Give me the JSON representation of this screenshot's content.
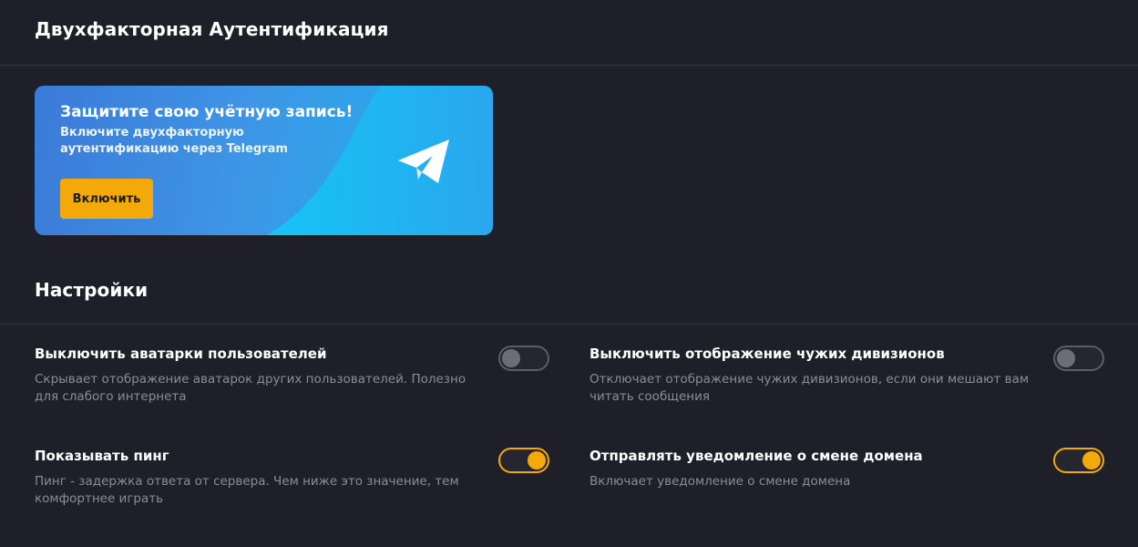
{
  "two_factor": {
    "section_title": "Двухфакторная Аутентификация",
    "banner": {
      "title": "Защитите свою учётную запись!",
      "text": "Включите двухфакторную аутентификацию через Telegram",
      "button_label": "Включить",
      "icon": "telegram-icon"
    }
  },
  "settings": {
    "section_title": "Настройки",
    "items": [
      {
        "title": "Выключить аватарки пользователей",
        "description": "Скрывает отображение аватарок других пользователей. Полезно для слабого интернета",
        "enabled": false
      },
      {
        "title": "Выключить отображение чужих дивизионов",
        "description": "Отключает отображение чужих дивизионов, если они мешают вам читать сообщения",
        "enabled": false
      },
      {
        "title": "Показывать пинг",
        "description": "Пинг - задержка ответа от сервера. Чем ниже это значение, тем комфортнее играть",
        "enabled": true
      },
      {
        "title": "Отправлять уведомление о смене домена",
        "description": "Включает уведомление о смене домена",
        "enabled": true
      }
    ]
  },
  "colors": {
    "background": "#1e1f29",
    "accent": "#f3a90a",
    "muted_text": "#8a8c97"
  }
}
